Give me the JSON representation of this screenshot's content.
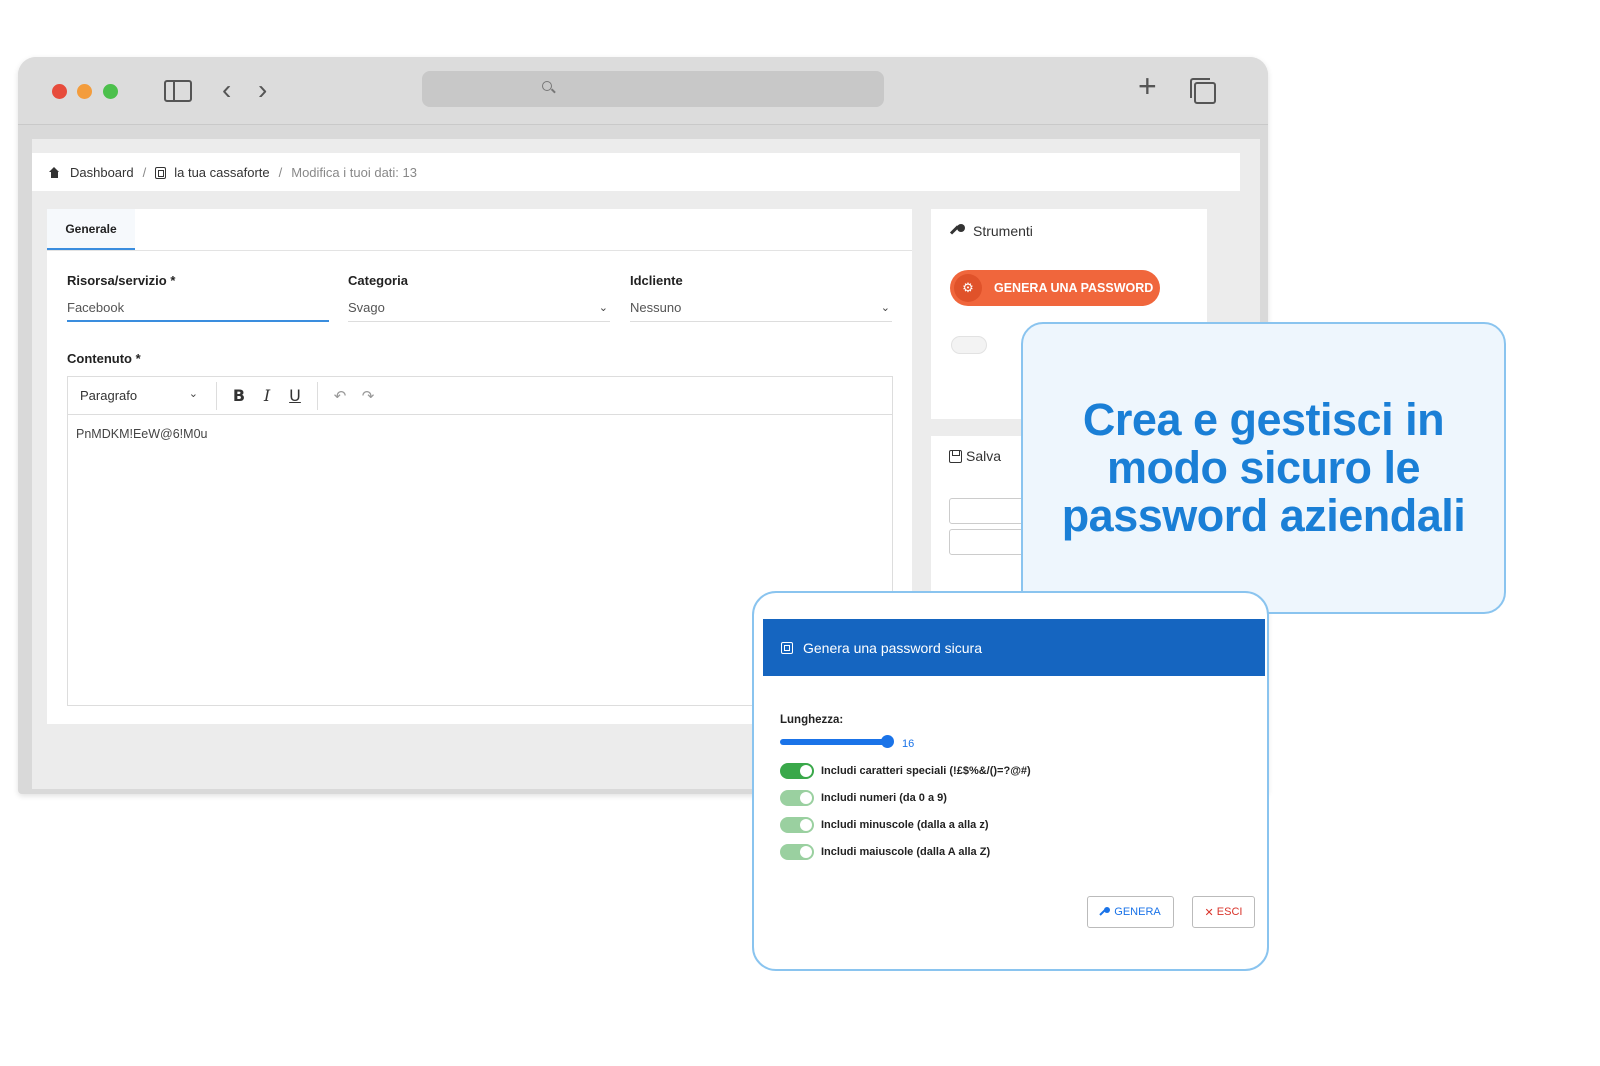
{
  "breadcrumb": {
    "home": "Dashboard",
    "sep1": "/",
    "vault": "la tua cassaforte",
    "sep2": "/",
    "current": "Modifica i tuoi dati: 13"
  },
  "tabs": {
    "general": "Generale"
  },
  "form": {
    "resource_label": "Risorsa/servizio *",
    "resource_value": "Facebook",
    "category_label": "Categoria",
    "category_value": "Svago",
    "client_label": "Idcliente",
    "client_value": "Nessuno",
    "content_label": "Contenuto *",
    "content_value": "PnMDKM!EeW@6!M0u"
  },
  "editor": {
    "paragraph_select": "Paragrafo",
    "bold": "B",
    "italic": "I",
    "underline": "U",
    "undo": "↶",
    "redo": "↷"
  },
  "tools": {
    "title": "Strumenti",
    "generate_password_button": "GENERA UNA PASSWORD",
    "save_title_partial": "Salva"
  },
  "promo": {
    "headline": "Crea e gestisci in modo sicuro le password aziendali"
  },
  "dialog": {
    "title": "Genera una password sicura",
    "length_label": "Lunghezza:",
    "length_value": 16,
    "length_min": 0,
    "length_max": 16,
    "length_display": "16",
    "options": [
      {
        "label": "Includi caratteri speciali (!£$%&/()=?@#)",
        "on": true
      },
      {
        "label": "Includi numeri (da 0 a 9)",
        "on": true
      },
      {
        "label": "Includi minuscole (dalla a alla z)",
        "on": true
      },
      {
        "label": "Includi maiuscole (dalla A alla Z)",
        "on": true
      }
    ],
    "generate_button": "GENERA",
    "exit_button": "ESCI"
  },
  "colors": {
    "accent": "#1a73e8",
    "header_blue": "#1565c0",
    "orange_button": "#f0663c",
    "promo_text": "#1a7fd6",
    "toggle_green": "#3aa84a",
    "exit_red": "#d9342b"
  },
  "icons": {
    "browser": [
      "sidebar-toggle-icon",
      "back-icon",
      "forward-icon",
      "search-icon",
      "plus-icon",
      "tabs-icon"
    ],
    "breadcrumb": [
      "house-icon",
      "safe-icon"
    ],
    "tools": [
      "wrench-icon",
      "password-gen-icon",
      "floppy-icon"
    ],
    "dialog": [
      "safe-icon",
      "key-icon",
      "x-icon"
    ]
  }
}
